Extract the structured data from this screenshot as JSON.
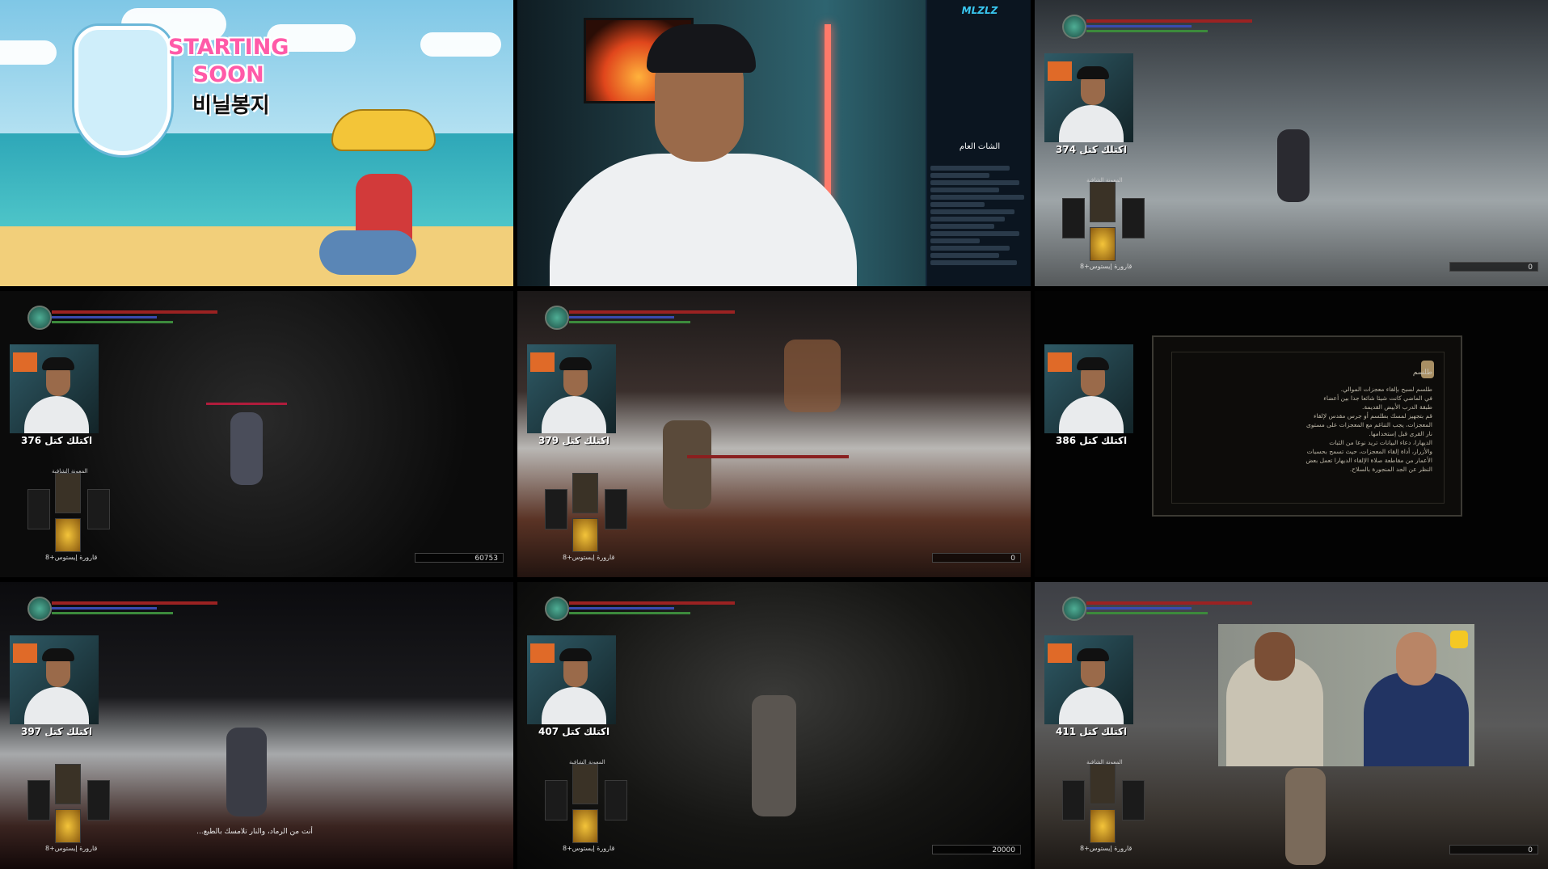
{
  "tile1": {
    "logo_line1": "STARTING",
    "logo_line2": "SOON",
    "logo_korean": "비닐봉지"
  },
  "tile2": {
    "chat_brand": "MLZLZ",
    "chat_title": "الشات العام"
  },
  "tiles": [
    {
      "kill": "اكتلك كتل 374",
      "souls": "0",
      "equip_title": "المعونة الشافية",
      "flask": "قارورة إيستوس+8"
    },
    {
      "kill": "اكتلك كتل 376",
      "souls": "60753",
      "equip_title": "المعونة الشافية",
      "flask": "قارورة إيستوس+8"
    },
    {
      "kill": "اكتلك كتل 379",
      "souls": "0",
      "equip_title": "",
      "flask": "قارورة إيستوس+8"
    },
    {
      "kill": "اكتلك كتل 386"
    },
    {
      "kill": "اكتلك كتل 397",
      "souls": "",
      "equip_title": "",
      "flask": "قارورة إيستوس+8",
      "subtitle": "أنت من الرماد، والنار تلامسك بالطبع..."
    },
    {
      "kill": "اكتلك كتل 407",
      "souls": "20000",
      "equip_title": "المعونة الشافية",
      "flask": "قارورة إيستوس+8"
    },
    {
      "kill": "اكتلك كتل 411",
      "souls": "0",
      "equip_title": "المعونة الشافية",
      "flask": "قارورة إيستوس+8"
    }
  ],
  "item_desc": {
    "title": "طلسم",
    "lines": [
      "طلسم لسبح بإلقاء معجزات الموالي.",
      "في الماضي كانت شيئا شائعا جدا بين أعضاء",
      "طبقة الدرب الأبيض القديمة.",
      "قم بتجهيز لمسك بطلسم أو جرس مقدس لإلقاء",
      "المعجزات، يجب التناغم مع المعجزات على مستوى",
      "نار القرى قبل إستخدامها.",
      "الديهارا، دعاء البيانات تريد نوعا من الثبات",
      "والأزرار، أداة إلقاء المعجزات، حيث تسمح بحسبات",
      "الأعمار من مقاطعة صلاة الإلقاء الديهارا تعمل بعض",
      "النظر عن الجد المنجورة بالسلاح."
    ]
  }
}
